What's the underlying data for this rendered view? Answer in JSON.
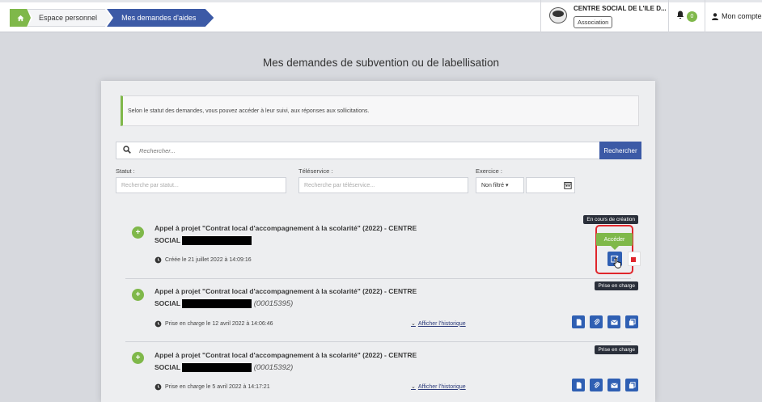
{
  "breadcrumb": {
    "home_icon": "home-icon",
    "personal_space": "Espace personnel",
    "current": "Mes demandes d'aides"
  },
  "organization": {
    "name": "CENTRE SOCIAL DE L'ILE D...",
    "type": "Association"
  },
  "notifications": {
    "count": "0"
  },
  "account": {
    "label": "Mon compte"
  },
  "page": {
    "title": "Mes demandes de subvention ou de labellisation"
  },
  "info_message": "Selon le statut des demandes, vous pouvez accéder à leur suivi, aux réponses aux sollicitations.",
  "filters": {
    "search_placeholder": "Rechercher...",
    "search_button": "Rechercher",
    "status_label": "Statut :",
    "status_placeholder": "Recherche par statut...",
    "teleservice_label": "Téléservice :",
    "teleservice_placeholder": "Recherche par téléservice...",
    "exercise_label": "Exercice :",
    "exercise_select": "Non filtré ▾"
  },
  "requests": [
    {
      "title": "Appel à projet \"Contrat local d'accompagnement à la scolarité\" (2022) - CENTRE",
      "title_line2": "SOCIAL",
      "reference": "",
      "date": "Créée le 21 juillet 2022 à 14:09:16",
      "status": "En cours de création",
      "action_tooltip": "Accéder",
      "history_link": ""
    },
    {
      "title": "Appel à projet \"Contrat local d'accompagnement à la scolarité\" (2022) - CENTRE",
      "title_line2": "SOCIAL",
      "reference": "(00015395)",
      "date": "Prise en charge le 12 avril 2022 à 14:06:46",
      "status": "Prise en charge",
      "history_link": "Afficher l'historique"
    },
    {
      "title": "Appel à projet \"Contrat local d'accompagnement à la scolarité\" (2022) - CENTRE",
      "title_line2": "SOCIAL",
      "reference": "(00015392)",
      "date": "Prise en charge le 5 avril 2022 à 14:17:21",
      "status": "Prise en charge",
      "history_link": "Afficher l'historique"
    }
  ]
}
